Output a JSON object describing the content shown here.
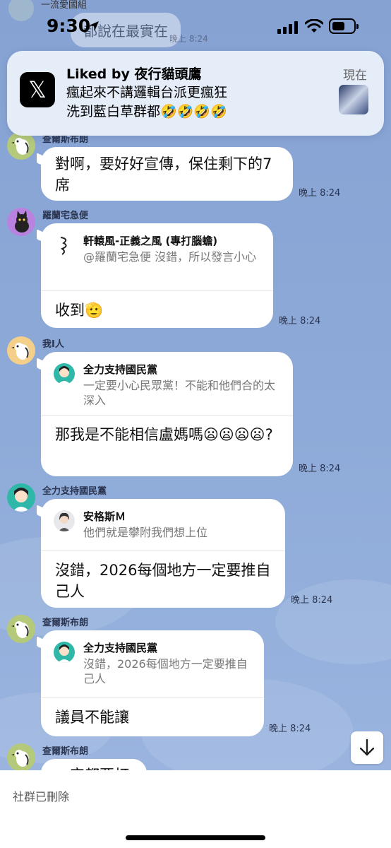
{
  "status_bar": {
    "time": "9:30"
  },
  "background_row": {
    "sender": "一流愛國組",
    "text": "都說在最實在",
    "time": "晚上 8:24"
  },
  "notification": {
    "app_icon": "x-logo-icon",
    "title": "Liked by 夜行貓頭鷹",
    "line1": "瘋起來不講邏輯台派更瘋狂",
    "line2": "洗到藍白草群都🤣🤣🤣🤣",
    "time": "現在"
  },
  "messages": [
    {
      "sender": "查爾斯布朗",
      "text": "對啊，要好好宣傳，保住剩下的7席",
      "time": "晚上 8:24"
    },
    {
      "sender": "羅蘭宅急便",
      "quote_name": "軒轅風-正義之風 (專打腦蟾)",
      "quote_text": "@羅蘭宅急便 沒錯，所以發言小心",
      "text": "收到🫡",
      "time": "晚上 8:24"
    },
    {
      "sender": "我I人",
      "quote_name": "全力支持國民黨",
      "quote_text": "一定要小心民眾黨！不能和他們合的太深入",
      "text": "那我是不能相信盧媽嗎😦😦😦😦?",
      "time": "晚上 8:24"
    },
    {
      "sender": "全力支持國民黨",
      "quote_name": "安格斯Ｍ",
      "quote_text": "他們就是攀附我們想上位",
      "text": "沒錯，2026每個地方一定要推自己人",
      "time": "晚上 8:24"
    },
    {
      "sender": "查爾斯布朗",
      "quote_name": "全力支持國民黨",
      "quote_text": "沒錯，2026每個地方一定要推自己人",
      "text": "議員不能讓",
      "time": "晚上 8:24"
    },
    {
      "sender": "查爾斯布朗",
      "text": "一定都要打",
      "time": ""
    }
  ],
  "scroll_button": {
    "icon": "arrow-down-icon"
  },
  "footer": {
    "text": "社群已刪除"
  }
}
